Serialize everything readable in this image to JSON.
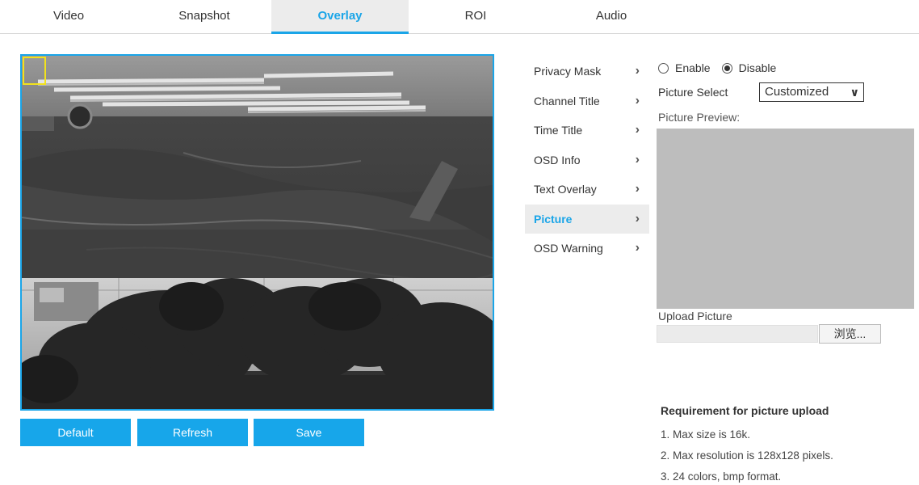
{
  "tabs": [
    "Video",
    "Snapshot",
    "Overlay",
    "ROI",
    "Audio"
  ],
  "active_tab": "Overlay",
  "menu": {
    "items": [
      "Privacy Mask",
      "Channel Title",
      "Time Title",
      "OSD Info",
      "Text Overlay",
      "Picture",
      "OSD Warning"
    ],
    "active": "Picture"
  },
  "buttons": {
    "default": "Default",
    "refresh": "Refresh",
    "save": "Save"
  },
  "settings": {
    "enable_label": "Enable",
    "disable_label": "Disable",
    "selected_state": "Disable",
    "picture_select_label": "Picture Select",
    "picture_select_value": "Customized",
    "picture_preview_label": "Picture Preview:",
    "upload_label": "Upload Picture",
    "browse_label": "浏览..."
  },
  "requirements": {
    "title": "Requirement for picture upload",
    "items": [
      "1. Max size is 16k.",
      "2. Max resolution is 128x128 pixels.",
      "3. 24 colors, bmp format."
    ]
  },
  "colors": {
    "accent": "#17a6ea",
    "overlay_box": "#f2e21c",
    "preview_bg": "#bdbdbd"
  }
}
